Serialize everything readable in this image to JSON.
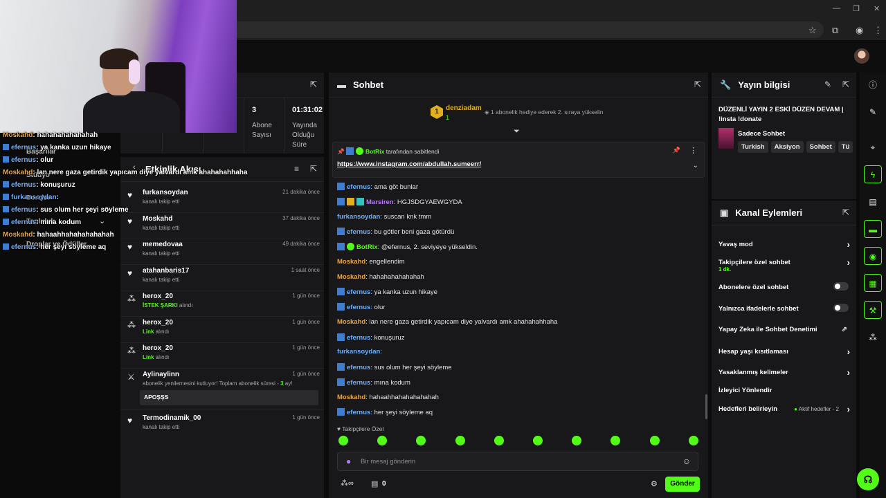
{
  "stats": {
    "subs_value": "3",
    "subs_label_1": "Abone",
    "subs_label_2": "Sayısı",
    "time_value": "01:31:02",
    "time_label_1": "Yayında",
    "time_label_2": "Olduğu",
    "time_label_3": "Süre"
  },
  "overlay": {
    "lines": [
      {
        "user": "Moskahd",
        "text": ": hahahahahahahah"
      },
      {
        "user": "efernus",
        "text": ": ya kanka uzun hikaye"
      },
      {
        "user": "efernus",
        "text": ": olur"
      },
      {
        "user": "Moskahd",
        "text": ": lan nere gaza getirdik yapıcam diye yalvardı amk ahahahahhaha"
      },
      {
        "user": "efernus",
        "text": ": konuşuruz"
      },
      {
        "user": "furkansoydan",
        "text": ":"
      },
      {
        "user": "efernus",
        "text": ": sus olum her şeyi söyleme"
      },
      {
        "user": "efernus",
        "text": ": mına kodum"
      },
      {
        "user": "Moskahd",
        "text": ": hahaahhahahahahahah"
      },
      {
        "user": "efernus",
        "text": ": her şeyi söyleme aq"
      }
    ],
    "menu_hints": [
      "Başarılar",
      "Stüdyo",
      "Dersler",
      "Topluluk",
      "Droplar ve Ödüller"
    ]
  },
  "activity": {
    "title": "Etkinlik Akışı",
    "items": [
      {
        "name": "furkansoydan",
        "sub": "kanalı takip etti",
        "time": "21 dakika önce",
        "icon": "heart-icon"
      },
      {
        "name": "Moskahd",
        "sub": "kanalı takip etti",
        "time": "37 dakika önce",
        "icon": "heart-icon"
      },
      {
        "name": "memedovaa",
        "sub": "kanalı takip etti",
        "time": "49 dakika önce",
        "icon": "heart-icon"
      },
      {
        "name": "atahanbaris17",
        "sub": "kanalı takip etti",
        "time": "1 saat önce",
        "icon": "heart-icon"
      },
      {
        "name": "herox_20",
        "sub_green": "İSTEK ŞARKI",
        "sub": " alındı",
        "time": "1 gün önce",
        "icon": "reward-icon"
      },
      {
        "name": "herox_20",
        "sub_green": "Link",
        "sub": " alındı",
        "time": "1 gün önce",
        "icon": "reward-icon"
      },
      {
        "name": "herox_20",
        "sub_green": "Link",
        "sub": " alındı",
        "time": "1 gün önce",
        "icon": "reward-icon"
      },
      {
        "name": "Aylinaylinn",
        "sub": "abonelik yenilemesini kutluyor! Toplam abonelik süresi - ",
        "sub_green": "3",
        "sub_tail": " ay!",
        "message": "APOŞŞS",
        "time": "1 gün önce",
        "icon": "sword-icon"
      },
      {
        "name": "Termodinamik_00",
        "sub": "kanalı takip etti",
        "time": "1 gün önce",
        "icon": "heart-icon"
      }
    ]
  },
  "chat": {
    "title": "Sohbet",
    "top_gifter": "denziadam",
    "top_gifter_rank": "1",
    "top_gifter_count": "1",
    "gift_hint": "1 abonelik hediye ederek 2. sıraya yükselin",
    "pinned_by": "BotRix",
    "pinned_label": "tarafından sabitlendi",
    "pinned_link": "https://www.instagram.com/abdullah.sumeerr/",
    "messages": [
      {
        "user": "efernus",
        "color": "blue",
        "text": ": ama göt bunlar",
        "badges": [
          "sq"
        ]
      },
      {
        "user": "Marsiren",
        "color": "purple",
        "text": ": HGJSDGYAEWGYDA",
        "badges": [
          "sq",
          "y",
          "t"
        ]
      },
      {
        "user": "furkansoydan",
        "color": "blue",
        "text": ": suscan knk tmm",
        "badges": []
      },
      {
        "user": "efernus",
        "color": "blue",
        "text": ": bu götler beni gaza götürdü",
        "badges": [
          "sq"
        ]
      },
      {
        "user": "BotRix",
        "color": "green",
        "text": ": @efernus, 2. seviyeye yükseldin.",
        "badges": [
          "sq",
          "gr"
        ]
      },
      {
        "user": "Moskahd",
        "color": "orange",
        "text": ": engellendim",
        "badges": []
      },
      {
        "user": "Moskahd",
        "color": "orange",
        "text": ": hahahahahahahah",
        "badges": []
      },
      {
        "user": "efernus",
        "color": "blue",
        "text": ": ya kanka uzun hikaye",
        "badges": [
          "sq"
        ]
      },
      {
        "user": "efernus",
        "color": "blue",
        "text": ": olur",
        "badges": [
          "sq"
        ]
      },
      {
        "user": "Moskahd",
        "color": "orange",
        "text": ": lan nere gaza getirdik yapıcam diye yalvardı amk ahahahahhaha",
        "badges": []
      },
      {
        "user": "efernus",
        "color": "blue",
        "text": ": konuşuruz",
        "badges": [
          "sq"
        ]
      },
      {
        "user": "furkansoydan",
        "color": "blue",
        "text": ":",
        "badges": []
      },
      {
        "user": "efernus",
        "color": "blue",
        "text": ": sus olum her şeyi söyleme",
        "badges": [
          "sq"
        ]
      },
      {
        "user": "efernus",
        "color": "blue",
        "text": ": mına kodum",
        "badges": [
          "sq"
        ]
      },
      {
        "user": "Moskahd",
        "color": "orange",
        "text": ": hahaahhahahahahahah",
        "badges": []
      },
      {
        "user": "efernus",
        "color": "blue",
        "text": ": her şeyi söyleme aq",
        "badges": [
          "sq"
        ]
      }
    ],
    "emote_section": "Takipçilere Özel",
    "input_placeholder": "Bir mesaj gönderin",
    "points": "0",
    "send_label": "Gönder"
  },
  "stream_info": {
    "title": "Yayın bilgisi",
    "stream_title": "DÜZENLİ YAYIN 2 ESKİ DÜZEN DEVAM | !insta !donate",
    "category": "Sadece Sohbet",
    "tags": [
      "Turkish",
      "Aksiyon",
      "Sohbet",
      "Tü"
    ]
  },
  "channel_actions": {
    "title": "Kanal Eylemleri",
    "rows": [
      {
        "label": "Yavaş mod",
        "control": "chevron"
      },
      {
        "label": "Takipçilere özel sohbet",
        "sub": "1 dk.",
        "control": "chevron"
      },
      {
        "label": "Abonelere özel sohbet",
        "control": "toggle"
      },
      {
        "label": "Yalnızca ifadelerle sohbet",
        "control": "toggle"
      },
      {
        "label": "Yapay Zeka ile Sohbet Denetimi",
        "control": "external"
      },
      {
        "label": "Hesap yaşı kısıtlaması",
        "control": "chevron"
      },
      {
        "label": "Yasaklanmış kelimeler",
        "control": "chevron"
      },
      {
        "label": "İzleyici Yönlendir",
        "control": "none"
      },
      {
        "label": "Hedefleri belirleyin",
        "control": "chevron",
        "status": "Aktif hedefler - 2"
      }
    ]
  },
  "colors": {
    "accent": "#53fc18",
    "orange": "#f0a43a",
    "blue": "#6bb0ff",
    "purple": "#b678ff"
  }
}
